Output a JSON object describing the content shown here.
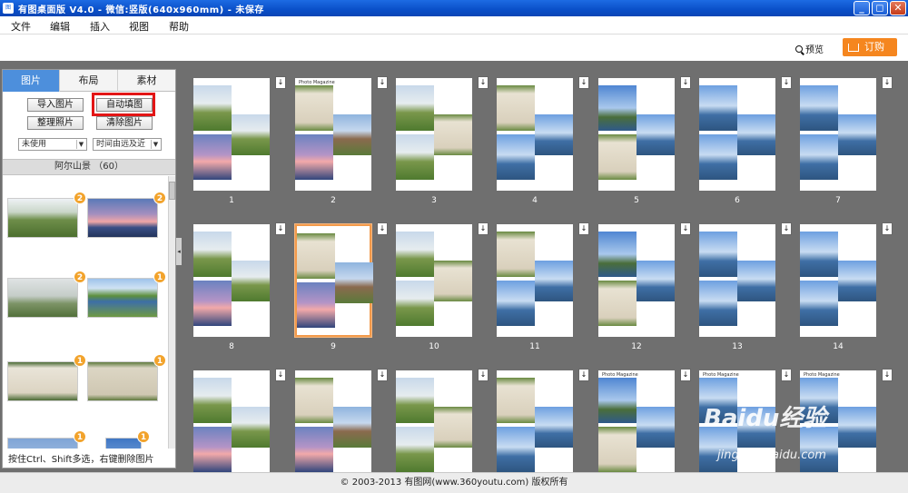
{
  "window": {
    "title": "有图桌面版 V4.0 - 微信:竖版(640x960mm) - 未保存",
    "minimize": "_",
    "restore": "◻",
    "close": "✕"
  },
  "menu": [
    "文件",
    "编辑",
    "插入",
    "视图",
    "帮助"
  ],
  "toolbar": {
    "preview_label": "预览",
    "order_label": "订购"
  },
  "left_panel": {
    "tabs": [
      "图片",
      "布局",
      "素材"
    ],
    "active_tab": "图片",
    "buttons": {
      "import": "导入图片",
      "autofill": "自动填图",
      "organize": "整理照片",
      "clear": "清除图片"
    },
    "filter_select": "未使用",
    "sort_select": "时间由远及近",
    "album_header": "阿尔山景 （60）",
    "thumb_badges": [
      "2",
      "2",
      "2",
      "1",
      "1",
      "1",
      "1",
      "1"
    ],
    "hint": "按住Ctrl、Shift多选，右键删除图片"
  },
  "pages": {
    "numbers": [
      "1",
      "2",
      "3",
      "4",
      "5",
      "6",
      "7",
      "8",
      "9",
      "10",
      "11",
      "12",
      "13",
      "14"
    ],
    "selected": "9",
    "magazine_text": "Photo Magazine"
  },
  "status_text": "© 2003-2013 有图网(www.360youtu.com) 版权所有",
  "watermark": {
    "brand": "Baidu经验",
    "url": "jingyan.baidu.com"
  },
  "colors": {
    "accent_tab": "#4d8fdc",
    "order": "#f5861f",
    "badge": "#f2a32c",
    "highlight": "#e31515",
    "workspace": "#6f6f6f"
  }
}
